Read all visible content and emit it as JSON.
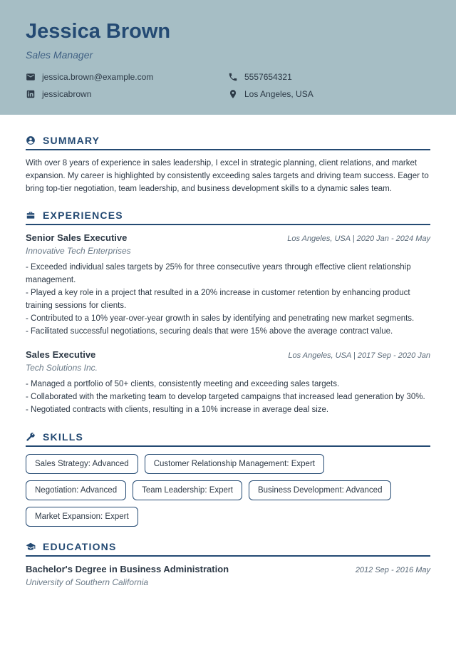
{
  "header": {
    "name": "Jessica Brown",
    "title": "Sales Manager",
    "email": "jessica.brown@example.com",
    "phone": "5557654321",
    "linkedin": "jessicabrown",
    "location": "Los Angeles, USA"
  },
  "sections": {
    "summary": {
      "heading": "SUMMARY",
      "text": "With over 8 years of experience in sales leadership, I excel in strategic planning, client relations, and market expansion. My career is highlighted by consistently exceeding sales targets and driving team success. Eager to bring top-tier negotiation, team leadership, and business development skills to a dynamic sales team."
    },
    "experiences": {
      "heading": "EXPERIENCES",
      "jobs": [
        {
          "title": "Senior Sales Executive",
          "company": "Innovative Tech Enterprises",
          "location": "Los Angeles, USA",
          "dates": "2020 Jan - 2024 May",
          "bullets": [
            "- Exceeded individual sales targets by 25% for three consecutive years through effective client relationship management.",
            "- Played a key role in a project that resulted in a 20% increase in customer retention by enhancing product training sessions for clients.",
            "- Contributed to a 10% year-over-year growth in sales by identifying and penetrating new market segments.",
            "- Facilitated successful negotiations, securing deals that were 15% above the average contract value."
          ]
        },
        {
          "title": "Sales Executive",
          "company": "Tech Solutions Inc.",
          "location": "Los Angeles, USA",
          "dates": "2017 Sep - 2020 Jan",
          "bullets": [
            "- Managed a portfolio of 50+ clients, consistently meeting and exceeding sales targets.",
            "- Collaborated with the marketing team to develop targeted campaigns that increased lead generation by 30%.",
            "- Negotiated contracts with clients, resulting in a 10% increase in average deal size."
          ]
        }
      ]
    },
    "skills": {
      "heading": "SKILLS",
      "items": [
        "Sales Strategy: Advanced",
        "Customer Relationship Management: Expert",
        "Negotiation: Advanced",
        "Team Leadership: Expert",
        "Business Development: Advanced",
        "Market Expansion: Expert"
      ]
    },
    "education": {
      "heading": "EDUCATIONS",
      "degree": "Bachelor's Degree in Business Administration",
      "school": "University of Southern California",
      "dates": "2012 Sep - 2016 May"
    }
  }
}
